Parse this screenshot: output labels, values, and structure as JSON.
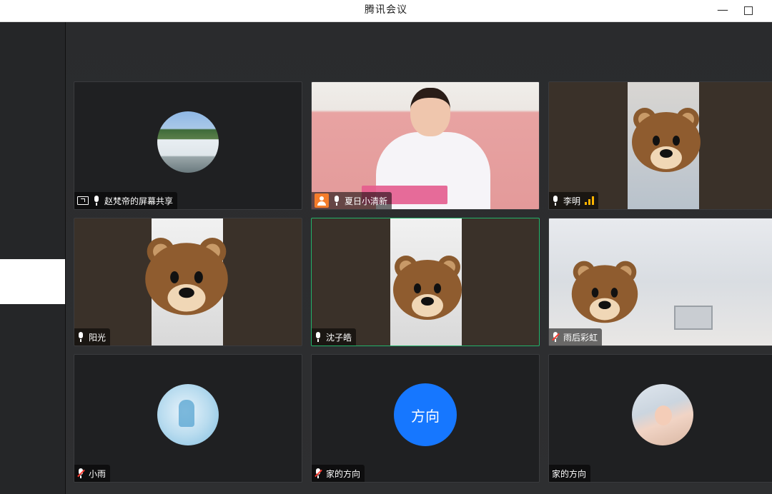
{
  "window": {
    "title": "腾讯会议",
    "controls": {
      "minimize": "—",
      "maximize": ""
    }
  },
  "tiles": [
    {
      "name": "赵梵帝的屏幕共享",
      "avatar": "waterfall-photo",
      "icons": [
        "screen-share-icon",
        "mic-icon"
      ]
    },
    {
      "name": "夏日小清新",
      "video": "woman-with-blocks",
      "icons": [
        "host-icon",
        "mic-icon"
      ]
    },
    {
      "name": "李明",
      "video": "bear-animoji",
      "icons": [
        "mic-icon",
        "signal-icon"
      ]
    },
    {
      "name": "阳光",
      "video": "bear-animoji",
      "icons": [
        "mic-icon"
      ]
    },
    {
      "name": "沈子皓",
      "video": "bear-animoji",
      "active_speaker": true,
      "icons": [
        "mic-icon"
      ]
    },
    {
      "name": "雨后彩虹",
      "video": "bear-animoji",
      "icons": [
        "mic-muted-icon"
      ]
    },
    {
      "name": "小雨",
      "avatar": "deer-picture",
      "icons": [
        "mic-muted-icon"
      ]
    },
    {
      "name": "家的方向",
      "avatar_text": "方向",
      "icons": [
        "mic-muted-icon"
      ]
    },
    {
      "name": "家的方向",
      "avatar": "baby-photo",
      "icons": []
    }
  ],
  "colors": {
    "active_border": "#22b36a",
    "avatar_blue": "#1677ff",
    "muted_red": "#ff3b30",
    "host_orange": "#f57c2a",
    "signal_yellow": "#ffb400"
  }
}
